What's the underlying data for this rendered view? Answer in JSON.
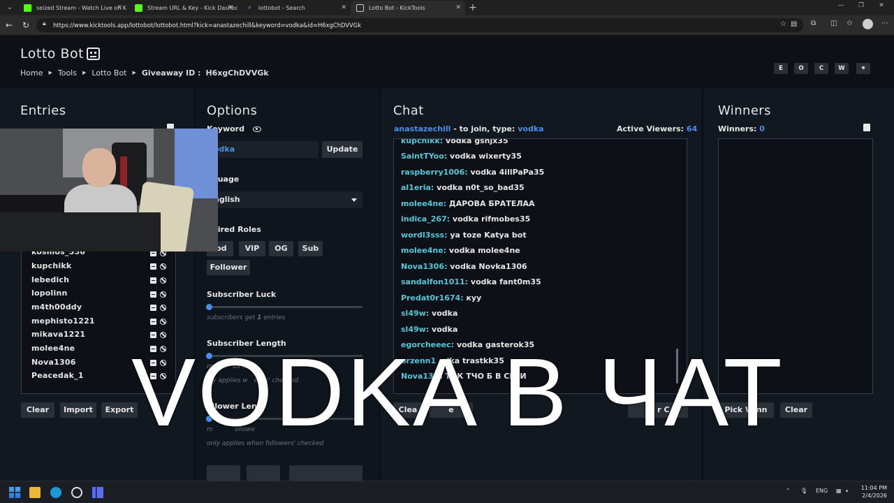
{
  "browser": {
    "tabs": [
      {
        "title": "seized Stream - Watch Live on Kic",
        "favicon": "kick-icon"
      },
      {
        "title": "Stream URL & Key - Kick Dashbo",
        "favicon": "kick-icon"
      },
      {
        "title": "lottobot - Search",
        "favicon": "search-icon"
      },
      {
        "title": "Lotto Bot - KickTools",
        "favicon": "kicktools-icon",
        "active": true
      }
    ],
    "url": "https://www.kicktools.app/lottobot/lottobot.html?kick=anastazechill&keyword=vodka&id=H6xgChDVVGk"
  },
  "page": {
    "title": "Lotto Bot",
    "breadcrumb": {
      "home": "Home",
      "tools": "Tools",
      "current": "Lotto Bot",
      "giveaway_label": "Giveaway ID :",
      "giveaway_id": "H6xgChDVVGk"
    },
    "theme_buttons": [
      "E",
      "O",
      "C",
      "W",
      "✷"
    ]
  },
  "entries": {
    "title": "Entries",
    "names": [
      "kosmos_556",
      "kupchikk",
      "lebedich",
      "lopolinn",
      "m4th00ddy",
      "mephisto1221",
      "mikava1221",
      "molee4ne",
      "Nova1306",
      "Peacedak_1"
    ],
    "buttons": {
      "clear": "Clear",
      "import": "Import",
      "export": "Export"
    }
  },
  "options": {
    "title": "Options",
    "keyword_label": "Keyword",
    "keyword_value": "odka",
    "update": "Update",
    "language_label": "nguage",
    "language_value": "nglish",
    "roles_label": "quired Roles",
    "roles": [
      "lod",
      "VIP",
      "OG",
      "Sub"
    ],
    "follower_role": "Follower",
    "sub_luck_label": "Subscriber Luck",
    "sub_luck_hint_pre": "subscribers get",
    "sub_luck_hint_num": "1",
    "sub_luck_hint_post": "entries",
    "sub_length_label": "Subscriber Length",
    "sub_length_hint_a": "m",
    "sub_length_hint_b": "bs subb",
    "sub_length_hint2_a": "nly applies w",
    "sub_length_hint2_b": "subs' checked",
    "follower_length_label": "ollower Leng",
    "follower_hint_a": "m",
    "follower_hint_b": "ollowe",
    "follower_hint2": "only applies when followers' checked"
  },
  "chat": {
    "title": "Chat",
    "channel": "anastazechill",
    "join_text": "- to join, type:",
    "keyword": "vodka",
    "viewers_label": "Active Viewers:",
    "viewers": "64",
    "messages": [
      {
        "user": "kupchikk:",
        "text": "vodka gsnjx35"
      },
      {
        "user": "SaintTYoo:",
        "text": "vodka wixerty35"
      },
      {
        "user": "raspberry1006:",
        "text": "vodka 4illPaPa35"
      },
      {
        "user": "al1eria:",
        "text": "vodka n0t_so_bad35"
      },
      {
        "user": "molee4ne:",
        "text": "ДАРОВА БРАТЕЛАА"
      },
      {
        "user": "indica_267:",
        "text": "vodka rifmobes35"
      },
      {
        "user": "wordl3sss:",
        "text": "ya toze Katya bot"
      },
      {
        "user": "molee4ne:",
        "text": "vodka molee4ne"
      },
      {
        "user": "Nova1306:",
        "text": "vodka Novka1306"
      },
      {
        "user": "sandalfon1011:",
        "text": "vodka fant0m35"
      },
      {
        "user": "Predat0r1674:",
        "text": "куу"
      },
      {
        "user": "sl49w:",
        "text": "vodka"
      },
      {
        "user": "sl49w:",
        "text": "vodka"
      },
      {
        "user": "egorcheeec:",
        "text": "vodka gasterok35"
      },
      {
        "user": "orzenn1",
        "text": "odka trastkk35"
      },
      {
        "user": "Nova13",
        "text": "Н ТОК ТЧО Б    В СЕТИ"
      }
    ],
    "clear_btn": "Clea",
    "other_btn": "e",
    "winner_chat_btn": "W     r C"
  },
  "winners": {
    "title": "Winners",
    "count_label": "Winners:",
    "count": "0",
    "pick_btn": "Pick Winn",
    "clear_btn": "Clear"
  },
  "caption": "VODKA В ЧАТ",
  "taskbar": {
    "lang": "ENG",
    "time": "11:04 PM",
    "date": "2/4/2026"
  }
}
